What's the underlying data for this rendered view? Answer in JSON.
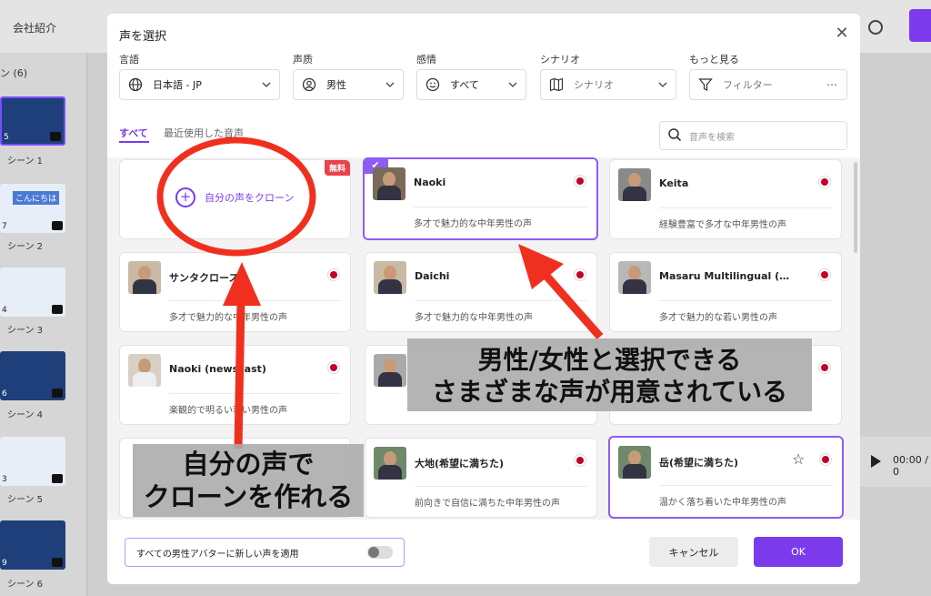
{
  "background": {
    "title": "会社紹介",
    "scene_count_label": "ン (6)",
    "scenes": [
      {
        "num": "5",
        "label": "シーン 1"
      },
      {
        "num": "7",
        "label": "シーン 2"
      },
      {
        "num": "4",
        "label": "シーン 3"
      },
      {
        "num": "6",
        "label": "シーン 4"
      },
      {
        "num": "3",
        "label": "シーン 5"
      },
      {
        "num": "9",
        "label": "シーン 6"
      }
    ],
    "thumb2_text": "こんにちは",
    "player_time": "00:00 / 0"
  },
  "modal": {
    "title": "声を選択",
    "close": "✕",
    "filters": [
      {
        "label": "言語",
        "value": "日本語 - JP",
        "icon": "globe-icon"
      },
      {
        "label": "声质",
        "value": "男性",
        "icon": "person-icon"
      },
      {
        "label": "感情",
        "value": "すべて",
        "icon": "smiley-icon"
      },
      {
        "label": "シナリオ",
        "value": "シナリオ",
        "icon": "map-icon"
      },
      {
        "label": "もっと見る",
        "value": "フィルター",
        "icon": "filter-icon"
      }
    ],
    "tabs": [
      "すべて",
      "最近使用した音声"
    ],
    "search_placeholder": "音声を検索",
    "clone_card": {
      "badge": "無料",
      "label": "自分の声をクローン"
    },
    "voices": [
      {
        "name": "Naoki",
        "desc": "多才で魅力的な中年男性の声",
        "selected": true
      },
      {
        "name": "Keita",
        "desc": "経験豊富で多才な中年男性の声"
      },
      {
        "name": "サンタクロース",
        "desc": "多才で魅力的な中年男性の声"
      },
      {
        "name": "Daichi",
        "desc": "多才で魅力的な中年男性の声"
      },
      {
        "name": "Masaru Multilingual (…",
        "desc": "多才で魅力的な若い男性の声"
      },
      {
        "name": "Naoki (newscast)",
        "desc": "楽観的で明るい若い男性の声"
      },
      {
        "name": "大地(希望に満ちた)",
        "desc": "前向きで自信に満ちた中年男性の声"
      },
      {
        "name": "岳(希望に満ちた)",
        "desc": "温かく落ち着いた中年男性の声",
        "selected": true
      }
    ],
    "footer": {
      "apply_all_label": "すべての男性アバターに新しい声を適用",
      "cancel": "キャンセル",
      "ok": "OK"
    }
  },
  "annotations": {
    "callout_right_line1": "男性/女性と選択できる",
    "callout_right_line2": "さまざまな声が用意されている",
    "callout_left_line1": "自分の声で",
    "callout_left_line2": "クローンを作れる",
    "arrow_color": "#f0301f"
  }
}
